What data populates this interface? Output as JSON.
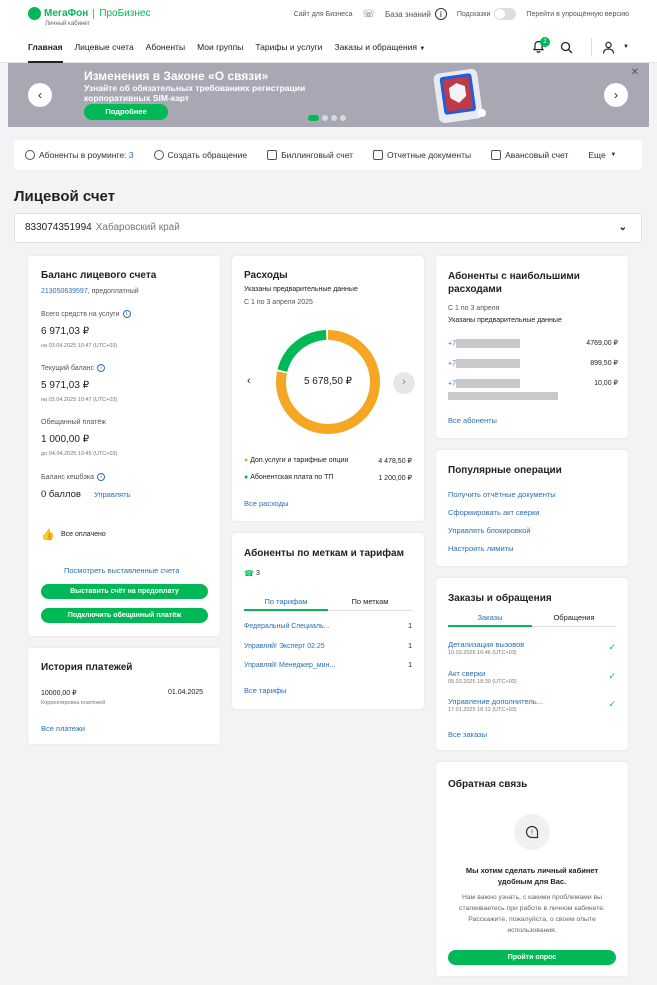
{
  "header": {
    "logo": "МегаФон",
    "logo_product": "ПроБизнес",
    "logo_sub": "Личный кабинет",
    "links": {
      "business_site": "Сайт для Бизнеса",
      "knowledge": "База знаний",
      "hints": "Подсказки",
      "simple_version": "Перейти в упрощённую версию"
    },
    "nav": [
      "Главная",
      "Лицевые счета",
      "Абоненты",
      "Мои группы",
      "Тарифы и услуги",
      "Заказы и обращения"
    ],
    "notif_count": "2"
  },
  "banner": {
    "title": "Изменения в Законе «О связи»",
    "text": "Узнайте об обязательных требованиях регистрации корпоративных SIM-карт",
    "button": "Подробнее"
  },
  "quickbar": {
    "roaming": "Абоненты в роуминге:",
    "roaming_count": "3",
    "create_request": "Создать обращение",
    "billing": "Биллинговый счет",
    "reports": "Отчетные документы",
    "advance": "Авансовый счет",
    "more": "Еще"
  },
  "account": {
    "section_title": "Лицевой счет",
    "number": "833074351994",
    "region": "Хабаровский край"
  },
  "balance": {
    "title": "Баланс лицевого счета",
    "account_link": "213050639597",
    "account_type": ", предоплатный",
    "total_label": "Всего средств на услуги",
    "total_value": "6 971,03 ₽",
    "total_date": "на 03.04.2025 10:47 (UTC+03)",
    "current_label": "Текущий баланс",
    "current_value": "5 971,03 ₽",
    "current_date": "на 03.04.2025 10:47 (UTC+03)",
    "promised_label": "Обещанный платёж",
    "promised_value": "1 000,00 ₽",
    "promised_date": "до 04.04.2025 10:45 (UTC+03)",
    "cashback_label": "Баланс кешбэка",
    "cashback_value": "0 баллов",
    "manage": "Управлять",
    "all_paid": "Все оплачено",
    "view_bills": "Посмотреть выставленные счета",
    "btn_prepay": "Выставить счёт на предоплату",
    "btn_promised": "Подключить обещанный платёж"
  },
  "payments": {
    "title": "История платежей",
    "amount": "10000,00 ₽",
    "note": "Корректировка платежей",
    "date": "01.04.2025",
    "all": "Все платежи"
  },
  "expenses": {
    "title": "Расходы",
    "subtitle": "Указаны предварительные данные",
    "period": "С 1 по 3 апреля 2025",
    "total": "5 678,50 ₽",
    "legend": [
      {
        "label": "Доп.услуги и тарифные опции",
        "value": "4 478,50 ₽",
        "color": "#f5a623",
        "amount": 4478.5
      },
      {
        "label": "Абонентская плата по ТП",
        "value": "1 200,00 ₽",
        "color": "#00b956",
        "amount": 1200.0
      }
    ],
    "all": "Все расходы"
  },
  "tags": {
    "title": "Абоненты по меткам и тарифам",
    "count": "3",
    "tab1": "По тарифам",
    "tab2": "По меткам",
    "rows": [
      {
        "name": "Федеральный Специаль...",
        "count": "1"
      },
      {
        "name": "Управляй! Эксперт 02.25",
        "count": "1"
      },
      {
        "name": "Управляй! Менеджер_мин...",
        "count": "1"
      }
    ],
    "all": "Все тарифы"
  },
  "top_subs": {
    "title": "Абоненты с наибольшими расходами",
    "period": "С 1 по 3 апреля",
    "subtitle": "Указаны предварительные данные",
    "rows": [
      {
        "prefix": "+7",
        "value": "4769,00 ₽"
      },
      {
        "prefix": "+7",
        "value": "899,50 ₽"
      },
      {
        "prefix": "+7",
        "value": "10,00 ₽"
      }
    ],
    "all": "Все абоненты"
  },
  "popular": {
    "title": "Популярные операции",
    "items": [
      "Получить отчётные документы",
      "Сформировать акт сверки",
      "Управлять блокировкой",
      "Настроить лимиты"
    ]
  },
  "orders": {
    "title": "Заказы и обращения",
    "tab1": "Заказы",
    "tab2": "Обращения",
    "rows": [
      {
        "name": "Детализация вызовов",
        "date": "10.03.2025 16:46 (UTC+03)"
      },
      {
        "name": "Акт сверки",
        "date": "05.03.2025 18:30 (UTC+03)"
      },
      {
        "name": "Управление дополнитель...",
        "date": "17.01.2025 18:12 (UTC+03)"
      }
    ],
    "all": "Все заказы"
  },
  "feedback": {
    "title": "Обратная связь",
    "heading": "Мы хотим сделать личный кабинет удобным для Вас.",
    "text": "Нам важно узнать, с какими проблемами вы сталкиваетесь при работе в личном кабинете. Расскажите, пожалуйста, о своем опыте использования.",
    "button": "Пройти опрос"
  }
}
